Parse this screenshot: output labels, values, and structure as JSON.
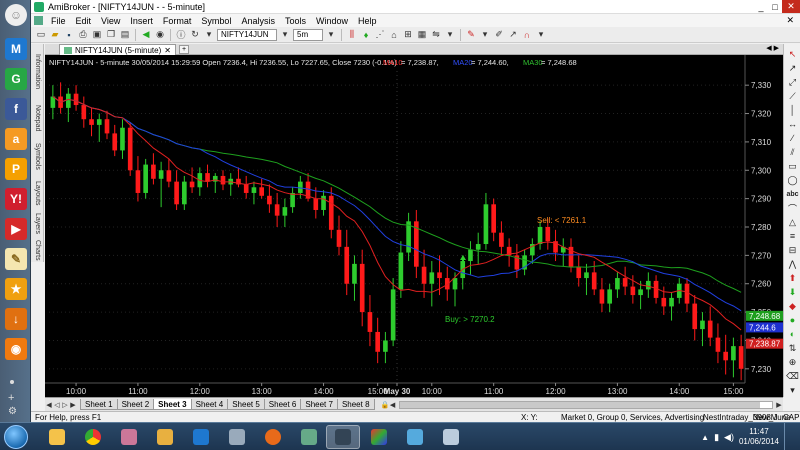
{
  "window": {
    "title": "AmiBroker - [NIFTY14JUN - - 5-minute]",
    "controls": [
      "_",
      "□",
      "✕"
    ]
  },
  "menu": [
    "File",
    "Edit",
    "View",
    "Insert",
    "Format",
    "Symbol",
    "Analysis",
    "Tools",
    "Window",
    "Help"
  ],
  "menu_close": "✕",
  "toolbar": {
    "symbol": "NIFTY14JUN",
    "interval": "5m"
  },
  "side_tabs": [
    "Information",
    "Notepad",
    "Symbols",
    "Layouts",
    "Layers",
    "Charts"
  ],
  "doc_tab": {
    "label": "NIFTY14JUN (5-minute)",
    "close": "✕",
    "new": "+"
  },
  "chart_data": {
    "type": "candlestick",
    "header": "NIFTY14JUN - 5-minute 30/05/2014 15:29:59 Open 7236.4, Hi 7236.55, Lo 7227.65, Close 7230 (-0.1%)",
    "ma_header": [
      {
        "label": "MA10",
        "value": "= 7,238.87,",
        "color": "#ff3030"
      },
      {
        "label": "MA20",
        "value": "= 7,244.60,",
        "color": "#3050ff"
      },
      {
        "label": "MA30",
        "value": "= 7,248.68",
        "color": "#30c030"
      }
    ],
    "ylim": [
      7225,
      7335
    ],
    "y_ticks": [
      "7,330",
      "7,320",
      "7,310",
      "7,300",
      "7,290",
      "7,280",
      "7,270",
      "7,260",
      "7,250",
      "7,240",
      "7,230"
    ],
    "x_ticks": [
      "10:00",
      "11:00",
      "12:00",
      "13:00",
      "14:00",
      "15:00",
      "May 30",
      "10:00",
      "11:00",
      "12:00",
      "13:00",
      "14:00",
      "15:00"
    ],
    "price_badges": [
      {
        "value": "7,248.68",
        "color": "#1e9e1e"
      },
      {
        "value": "7,244.6",
        "color": "#1e30d0"
      },
      {
        "value": "7,238.87",
        "color": "#d02020"
      }
    ],
    "annotations": [
      {
        "text": "Sell: < 7261.1",
        "color": "#ff8c20"
      },
      {
        "text": "Buy: > 7270.2",
        "color": "#2ecc2e"
      }
    ],
    "candles": [
      [
        7322,
        7330,
        7318,
        7326
      ],
      [
        7326,
        7331,
        7320,
        7322
      ],
      [
        7322,
        7329,
        7317,
        7327
      ],
      [
        7327,
        7330,
        7321,
        7323
      ],
      [
        7323,
        7326,
        7315,
        7318
      ],
      [
        7318,
        7322,
        7312,
        7316
      ],
      [
        7316,
        7320,
        7310,
        7318
      ],
      [
        7318,
        7321,
        7311,
        7313
      ],
      [
        7313,
        7316,
        7305,
        7307
      ],
      [
        7307,
        7318,
        7304,
        7315
      ],
      [
        7315,
        7317,
        7298,
        7300
      ],
      [
        7300,
        7305,
        7289,
        7292
      ],
      [
        7292,
        7304,
        7290,
        7302
      ],
      [
        7302,
        7306,
        7295,
        7297
      ],
      [
        7297,
        7303,
        7287,
        7300
      ],
      [
        7300,
        7304,
        7294,
        7296
      ],
      [
        7296,
        7300,
        7286,
        7288
      ],
      [
        7288,
        7298,
        7286,
        7296
      ],
      [
        7296,
        7301,
        7292,
        7294
      ],
      [
        7294,
        7301,
        7291,
        7299
      ],
      [
        7299,
        7302,
        7294,
        7296
      ],
      [
        7296,
        7299,
        7292,
        7298
      ],
      [
        7298,
        7300,
        7293,
        7295
      ],
      [
        7295,
        7299,
        7291,
        7297
      ],
      [
        7297,
        7301,
        7294,
        7295
      ],
      [
        7295,
        7298,
        7290,
        7292
      ],
      [
        7292,
        7296,
        7288,
        7294
      ],
      [
        7294,
        7297,
        7290,
        7291
      ],
      [
        7291,
        7295,
        7285,
        7288
      ],
      [
        7288,
        7292,
        7280,
        7284
      ],
      [
        7284,
        7290,
        7280,
        7287
      ],
      [
        7287,
        7294,
        7285,
        7292
      ],
      [
        7292,
        7298,
        7290,
        7296
      ],
      [
        7296,
        7299,
        7289,
        7290
      ],
      [
        7290,
        7294,
        7283,
        7286
      ],
      [
        7286,
        7293,
        7284,
        7291
      ],
      [
        7291,
        7294,
        7276,
        7279
      ],
      [
        7279,
        7284,
        7270,
        7273
      ],
      [
        7273,
        7279,
        7256,
        7260
      ],
      [
        7260,
        7270,
        7254,
        7267
      ],
      [
        7267,
        7272,
        7245,
        7250
      ],
      [
        7250,
        7256,
        7238,
        7243
      ],
      [
        7243,
        7248,
        7232,
        7236
      ],
      [
        7236,
        7243,
        7232,
        7240
      ],
      [
        7240,
        7262,
        7238,
        7258
      ],
      [
        7258,
        7275,
        7255,
        7271
      ],
      [
        7271,
        7285,
        7268,
        7282
      ],
      [
        7282,
        7286,
        7262,
        7266
      ],
      [
        7266,
        7272,
        7255,
        7260
      ],
      [
        7260,
        7268,
        7252,
        7264
      ],
      [
        7264,
        7270,
        7256,
        7262
      ],
      [
        7262,
        7266,
        7254,
        7258
      ],
      [
        7258,
        7264,
        7252,
        7262
      ],
      [
        7262,
        7270,
        7258,
        7268
      ],
      [
        7268,
        7275,
        7263,
        7272
      ],
      [
        7272,
        7278,
        7267,
        7274
      ],
      [
        7274,
        7292,
        7272,
        7288
      ],
      [
        7288,
        7290,
        7275,
        7278
      ],
      [
        7278,
        7282,
        7270,
        7273
      ],
      [
        7273,
        7276,
        7266,
        7270
      ],
      [
        7270,
        7274,
        7262,
        7265
      ],
      [
        7265,
        7272,
        7263,
        7270
      ],
      [
        7270,
        7276,
        7267,
        7274
      ],
      [
        7274,
        7282,
        7272,
        7280
      ],
      [
        7280,
        7283,
        7272,
        7275
      ],
      [
        7275,
        7279,
        7268,
        7271
      ],
      [
        7271,
        7276,
        7266,
        7273
      ],
      [
        7273,
        7276,
        7264,
        7266
      ],
      [
        7266,
        7270,
        7259,
        7262
      ],
      [
        7262,
        7267,
        7256,
        7264
      ],
      [
        7264,
        7268,
        7256,
        7258
      ],
      [
        7258,
        7262,
        7250,
        7253
      ],
      [
        7253,
        7260,
        7250,
        7258
      ],
      [
        7258,
        7264,
        7255,
        7262
      ],
      [
        7262,
        7266,
        7256,
        7259
      ],
      [
        7259,
        7263,
        7253,
        7256
      ],
      [
        7256,
        7261,
        7251,
        7258
      ],
      [
        7258,
        7264,
        7255,
        7261
      ],
      [
        7261,
        7263,
        7253,
        7255
      ],
      [
        7255,
        7259,
        7249,
        7252
      ],
      [
        7252,
        7257,
        7247,
        7255
      ],
      [
        7255,
        7262,
        7253,
        7260
      ],
      [
        7260,
        7262,
        7250,
        7253
      ],
      [
        7253,
        7256,
        7240,
        7244
      ],
      [
        7244,
        7250,
        7238,
        7247
      ],
      [
        7247,
        7252,
        7238,
        7241
      ],
      [
        7241,
        7246,
        7232,
        7236
      ],
      [
        7236,
        7242,
        7228,
        7233
      ],
      [
        7233,
        7241,
        7227,
        7238
      ],
      [
        7238,
        7242,
        7226,
        7230
      ]
    ]
  },
  "sheets": [
    "Sheet 1",
    "Sheet 2",
    "Sheet 3",
    "Sheet 4",
    "Sheet 5",
    "Sheet 6",
    "Sheet 7",
    "Sheet 8"
  ],
  "active_sheet": "Sheet 3",
  "status": {
    "help": "For Help, press F1",
    "xy": "X:   Y:",
    "market": "Market 0, Group 0, Services, Advertising",
    "db": "NestIntraday_New_June",
    "mem": "3908M",
    "cap": "CAP"
  },
  "clock": {
    "time": "11:47",
    "date": "01/06/2014"
  },
  "launcher": [
    {
      "icon": "maxthon-icon",
      "glyph": "M",
      "color": "#1e78d0"
    },
    {
      "icon": "gmail-icon",
      "glyph": "G",
      "color": "#27a745"
    },
    {
      "icon": "facebook-icon",
      "glyph": "f",
      "color": "#3b5998"
    },
    {
      "icon": "amazon-icon",
      "glyph": "a",
      "color": "#f59a23"
    },
    {
      "icon": "paypal-icon",
      "glyph": "P",
      "color": "#f5a000"
    },
    {
      "icon": "yahoo-icon",
      "glyph": "Y!",
      "color": "#d01e2e"
    },
    {
      "icon": "youtube-icon",
      "glyph": "▶",
      "color": "#d62a2a"
    },
    {
      "icon": "notes-icon",
      "glyph": "✎",
      "color": "#f5e6b0"
    },
    {
      "icon": "favorites-icon",
      "glyph": "★",
      "color": "#f0a010"
    },
    {
      "icon": "download-icon",
      "glyph": "↓",
      "color": "#e07010"
    },
    {
      "icon": "rss-icon",
      "glyph": "◉",
      "color": "#f07a10"
    }
  ]
}
